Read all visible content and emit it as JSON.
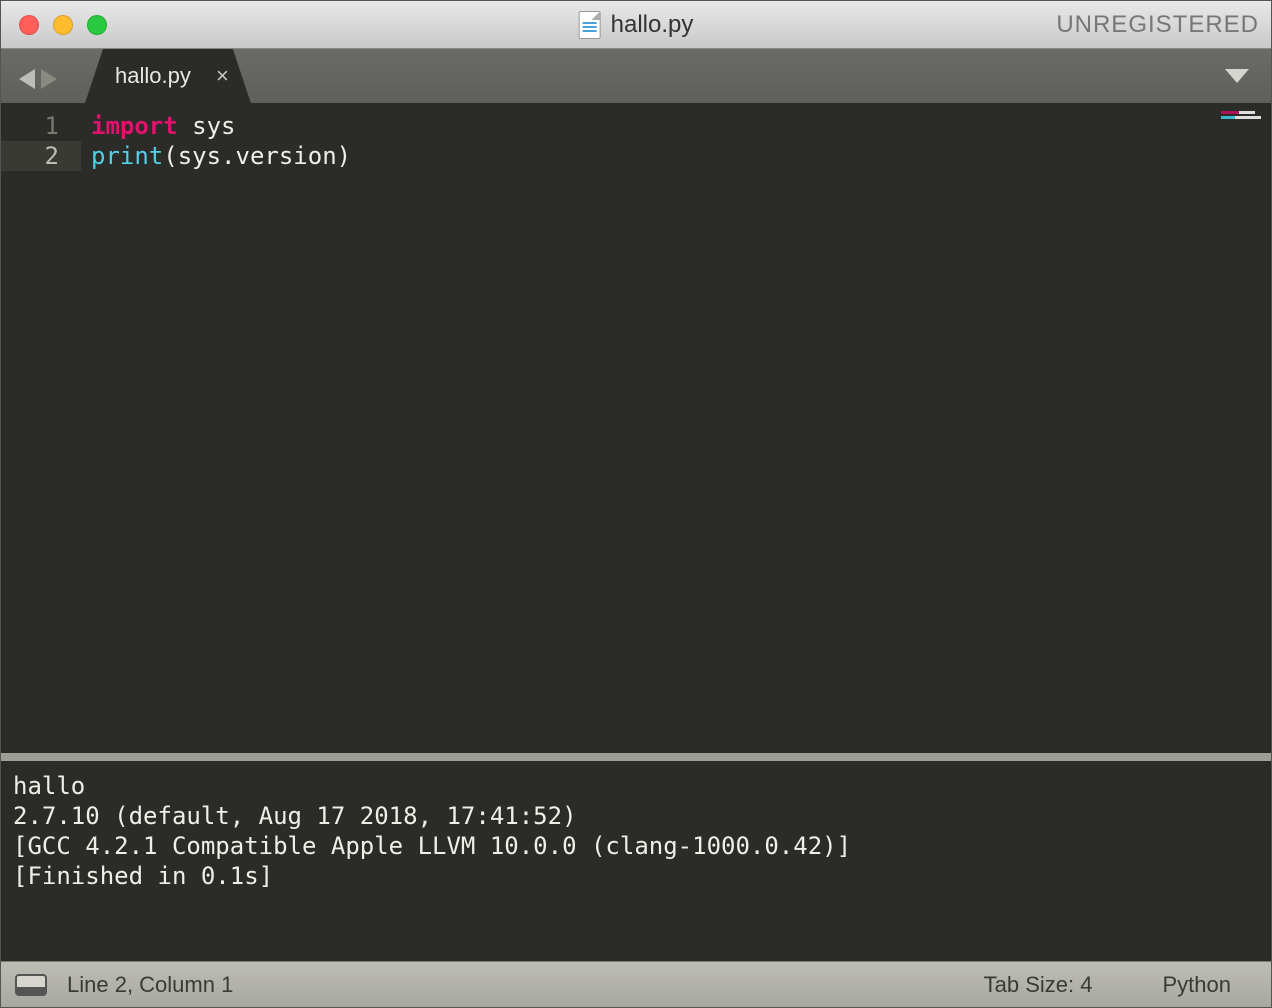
{
  "titlebar": {
    "filename": "hallo.py",
    "unregistered": "UNREGISTERED"
  },
  "tab": {
    "label": "hallo.py"
  },
  "gutter": {
    "lines": [
      "1",
      "2"
    ],
    "active_line_index": 1
  },
  "code": {
    "line1": {
      "kw": "import",
      "rest": " sys"
    },
    "line2": {
      "fn": "print",
      "rest": "(sys.version)"
    }
  },
  "output": {
    "lines": [
      "hallo",
      "2.7.10 (default, Aug 17 2018, 17:41:52) ",
      "[GCC 4.2.1 Compatible Apple LLVM 10.0.0 (clang-1000.0.42)]",
      "[Finished in 0.1s]"
    ]
  },
  "status": {
    "cursor": "Line 2, Column 1",
    "tabsize": "Tab Size: 4",
    "syntax": "Python"
  }
}
